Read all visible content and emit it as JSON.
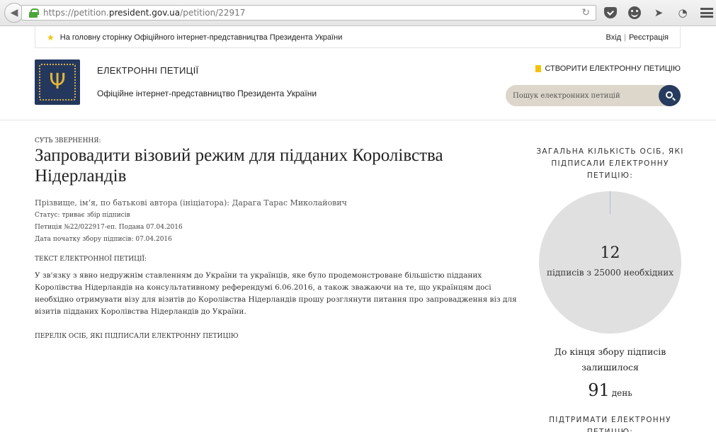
{
  "browser": {
    "url_prefix": "https://petition.",
    "url_domain": "president.gov.ua",
    "url_path": "/petition/22917"
  },
  "top_strip": {
    "home_link": "На головну сторінку Офіційного інтернет-представництва Президента України",
    "login": "Вхід",
    "separator": "|",
    "register": "Реєстрація"
  },
  "header": {
    "title": "ЕЛЕКТРОННІ ПЕТИЦІЇ",
    "subtitle": "Офіційне інтернет-представництво Президента України",
    "create_link": "СТВОРИТИ ЕЛЕКТРОННУ ПЕТИЦІЮ",
    "search_placeholder": "Пошук електронних петицій",
    "trident_glyph": "Ψ"
  },
  "petition": {
    "essence_label": "СУТЬ ЗВЕРНЕННЯ:",
    "title": "Запровадити візовий режим для підданих Королівства Нідерландів",
    "author": "Прізвище, ім’я, по батькові автора (ініціатора): Дарага Тарас Миколайович",
    "status": "Статус: триває збір підписів",
    "number": "Петиція №22/022917-еп. Подана 07.04.2016",
    "start_date": "Дата початку збору підписів: 07.04.2016",
    "text_label": "ТЕКСТ ЕЛЕКТРОННОЇ ПЕТИЦІЇ:",
    "text": "У зв'язку з явно недружнім ставленням до України та українців, яке було продемонстроване більшістю підданих Королівства Нідерландів на консультативному референдумі 6.06.2016, а також зважаючи на те, що українцям досі необхідно отримувати візу для візитів до Королівства Нідерландів прошу розглянути питання про запровадження віз для візитів підданих Королівства Нідерландів до України.",
    "signers_link": "ПЕРЕЛІК ОСІБ, ЯКІ ПІДПИСАЛИ ЕЛЕКТРОННУ ПЕТИЦІЮ"
  },
  "sidebar": {
    "total_label": "ЗАГАЛЬНА КІЛЬКІСТЬ ОСІБ, ЯКІ ПІДПИСАЛИ ЕЛЕКТРОННУ ПЕТИЦІЮ:",
    "count": "12",
    "count_sub": "підписів з 25000 необхідних",
    "signatures": 12,
    "required": 25000,
    "remaining_label": "До кінця збору підписів залишилося",
    "days_number": "91",
    "days_unit": "день",
    "support_label": "ПІДТРИМАТИ ЕЛЕКТРОННУ ПЕТИЦІЮ:"
  },
  "colors": {
    "navy": "#263b5e",
    "gold": "#e1b53a",
    "star": "#f4c20d",
    "search_bg": "#ddd6ca",
    "circle_bg": "#e0e0e0"
  }
}
